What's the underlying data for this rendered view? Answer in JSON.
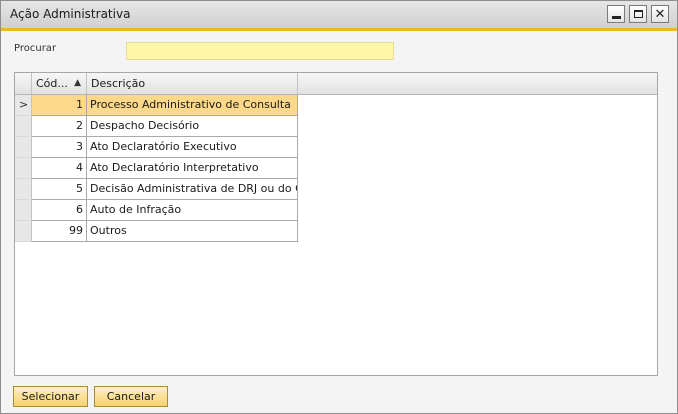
{
  "window": {
    "title": "Ação Administrativa",
    "minimize_glyph": "",
    "close_glyph": "✕"
  },
  "search": {
    "label": "Procurar",
    "value": "",
    "placeholder": ""
  },
  "grid": {
    "columns": [
      {
        "label": "Cód...",
        "sort": "ascending"
      },
      {
        "label": "Descrição"
      }
    ],
    "sort_glyph": "▲",
    "row_pointer_glyph": ">",
    "selected_row": 0,
    "rows": [
      {
        "code": "1",
        "description": "Processo Administrativo de Consulta"
      },
      {
        "code": "2",
        "description": "Despacho Decisório"
      },
      {
        "code": "3",
        "description": "Ato Declaratório Executivo"
      },
      {
        "code": "4",
        "description": "Ato Declaratório Interpretativo"
      },
      {
        "code": "5",
        "description": "Decisão Administrativa de DRJ ou do CARF"
      },
      {
        "code": "6",
        "description": "Auto de Infração"
      },
      {
        "code": "99",
        "description": "Outros"
      }
    ]
  },
  "buttons": {
    "select_label": "Selecionar",
    "cancel_label": "Cancelar"
  },
  "colors": {
    "accent": "#f0b424",
    "selected_row": "#fcd88a",
    "search_field": "#fff6a8",
    "button_face": "#f6d36e"
  }
}
